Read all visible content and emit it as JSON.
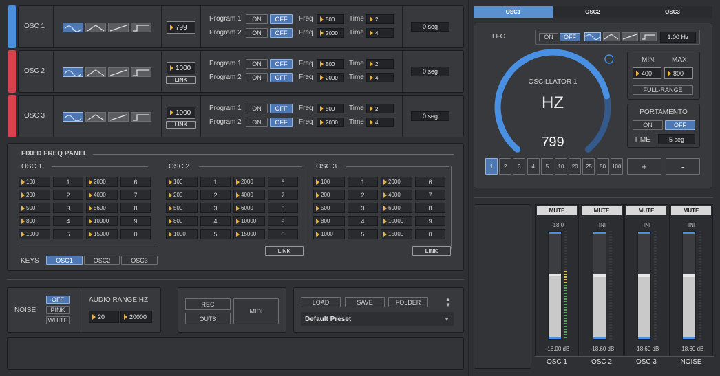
{
  "osc_rows": [
    {
      "name": "OSC 1",
      "value": "799",
      "link": "",
      "prog1_on": "ON",
      "prog1_off": "OFF",
      "prog2_on": "ON",
      "prog2_off": "OFF",
      "program1": "Program 1",
      "program2": "Program 2",
      "freq_label": "Freq",
      "time_label": "Time",
      "freq1": "500",
      "freq2": "2000",
      "time1": "2",
      "time2": "4",
      "seg": "0 seg",
      "color": "#4a8fe0"
    },
    {
      "name": "OSC 2",
      "value": "1000",
      "link": "LINK",
      "prog1_on": "ON",
      "prog1_off": "OFF",
      "prog2_on": "ON",
      "prog2_off": "OFF",
      "program1": "Program 1",
      "program2": "Program 2",
      "freq_label": "Freq",
      "time_label": "Time",
      "freq1": "500",
      "freq2": "2000",
      "time1": "2",
      "time2": "4",
      "seg": "0 seg",
      "color": "#d9434e"
    },
    {
      "name": "OSC 3",
      "value": "1000",
      "link": "LINK",
      "prog1_on": "ON",
      "prog1_off": "OFF",
      "prog2_on": "ON",
      "prog2_off": "OFF",
      "program1": "Program 1",
      "program2": "Program 2",
      "freq_label": "Freq",
      "time_label": "Time",
      "freq1": "500",
      "freq2": "2000",
      "time1": "2",
      "time2": "4",
      "seg": "0 seg",
      "color": "#d9434e"
    }
  ],
  "fixed": {
    "title": "FIXED FREQ PANEL",
    "groups": [
      {
        "name": "OSC 1",
        "link": ""
      },
      {
        "name": "OSC 2",
        "link": "LINK"
      },
      {
        "name": "OSC 3",
        "link": "LINK"
      }
    ],
    "freqs_a": [
      "100",
      "200",
      "500",
      "800",
      "1000"
    ],
    "nums_a": [
      "1",
      "2",
      "3",
      "4",
      "5"
    ],
    "freqs_b": [
      "2000",
      "4000",
      "5600",
      "10000",
      "15000"
    ],
    "nums_b": [
      "6",
      "7",
      "8",
      "9",
      "0"
    ],
    "freqs_b_alt": [
      "2000",
      "4000",
      "6000",
      "10000",
      "15000"
    ],
    "keys_label": "KEYS",
    "keys": [
      "OSC1",
      "OSC2",
      "OSC3"
    ]
  },
  "noise": {
    "label": "NOISE",
    "opts": [
      "OFF",
      "PINK",
      "WHITE"
    ],
    "range_label": "AUDIO RANGE HZ",
    "min": "20",
    "max": "20000"
  },
  "io": {
    "rec": "REC",
    "outs": "OUTS",
    "midi": "MIDI"
  },
  "preset": {
    "load": "LOAD",
    "save": "SAVE",
    "folder": "FOLDER",
    "name": "Default Preset"
  },
  "right": {
    "tabs": [
      "OSC1",
      "OSC2",
      "OSC3"
    ],
    "lfo_label": "LFO",
    "lfo_on": "ON",
    "lfo_off": "OFF",
    "lfo_rate": "1.00 Hz",
    "dial_title": "OSCILLATOR 1",
    "dial_unit": "HZ",
    "dial_value": "799",
    "dial_level": 0.78,
    "min_label": "MIN",
    "max_label": "MAX",
    "min": "400",
    "max": "800",
    "full_range": "FULL-RANGE",
    "portamento": "PORTAMENTO",
    "port_on": "ON",
    "port_off": "OFF",
    "time_label": "TIME",
    "time_val": "5 seg",
    "steps": [
      "1",
      "2",
      "3",
      "4",
      "5",
      "10",
      "20",
      "25",
      "50",
      "100"
    ],
    "plus": "+",
    "minus": "-"
  },
  "meters": [
    {
      "mute": "MUTE",
      "top": "-18.0",
      "db": "-18.00 dB",
      "name": "OSC 1",
      "level": 0.58
    },
    {
      "mute": "MUTE",
      "top": "-INF",
      "db": "-18.60 dB",
      "name": "OSC 2",
      "level": 0.57
    },
    {
      "mute": "MUTE",
      "top": "-INF",
      "db": "-18.60 dB",
      "name": "OSC 3",
      "level": 0.57
    },
    {
      "mute": "MUTE",
      "top": "-INF",
      "db": "-18.60 dB",
      "name": "NOISE",
      "level": 0.57
    }
  ],
  "colors": {
    "accent": "#4d78b4",
    "dial": "#4a90e2",
    "osc1": "#4a8fe0",
    "osc23": "#d9434e",
    "arrow": "#e9b23a"
  }
}
